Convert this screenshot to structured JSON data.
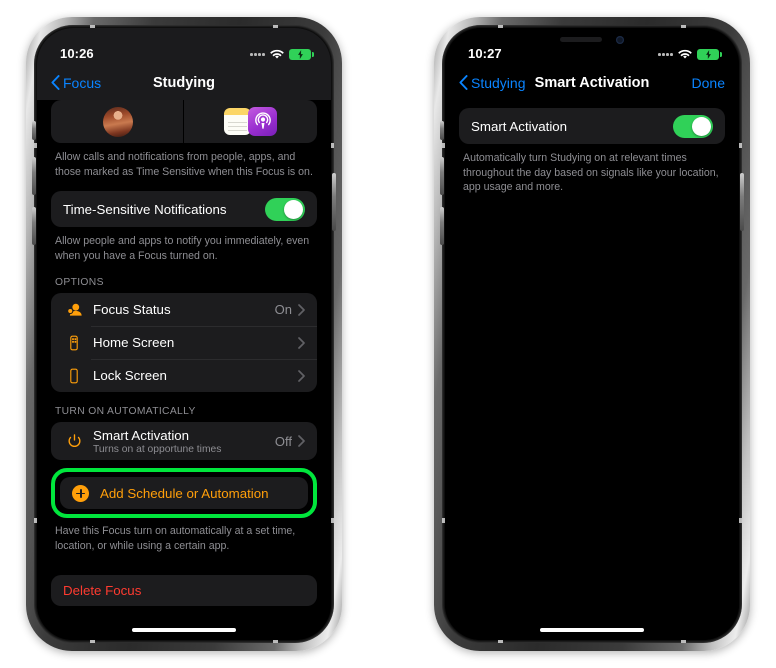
{
  "phones": [
    {
      "id": "focus-studying",
      "status_bar": {
        "time": "10:26",
        "signal": "signal-dots-icon",
        "wifi": "wifi-icon",
        "battery": "battery-charging-icon"
      },
      "nav": {
        "back_label": "Focus",
        "title": "Studying",
        "done_label": ""
      },
      "people_strip": {
        "avatar": "person-avatar",
        "app_icons": [
          "notes-app-icon",
          "podcasts-app-icon"
        ]
      },
      "footnote_1": "Allow calls and notifications from people, apps, and those marked as Time Sensitive when this Focus is on.",
      "time_sensitive": {
        "label": "Time-Sensitive Notifications",
        "toggle_state": "on"
      },
      "footnote_2": "Allow people and apps to notify you immediately, even when you have a Focus turned on.",
      "options_header": "OPTIONS",
      "options_rows": [
        {
          "label": "Focus Status",
          "value": "On",
          "icon": "focus-status-icon"
        },
        {
          "label": "Home Screen",
          "value": "",
          "icon": "home-screen-icon"
        },
        {
          "label": "Lock Screen",
          "value": "",
          "icon": "lock-screen-icon"
        }
      ],
      "turn_on_header": "TURN ON AUTOMATICALLY",
      "smart_activation_row": {
        "label": "Smart Activation",
        "sub": "Turns on at opportune times",
        "value": "Off",
        "icon": "power-icon"
      },
      "add_row": {
        "label": "Add Schedule or Automation",
        "icon": "plus-circle-icon"
      },
      "footnote_3": "Have this Focus turn on automatically at a set time, location, or while using a certain app.",
      "delete_label": "Delete Focus"
    },
    {
      "id": "smart-activation",
      "status_bar": {
        "time": "10:27",
        "signal": "signal-dots-icon",
        "wifi": "wifi-icon",
        "battery": "battery-charging-icon"
      },
      "nav": {
        "back_label": "Studying",
        "title": "Smart Activation",
        "done_label": "Done"
      },
      "smart_activation_toggle": {
        "label": "Smart Activation",
        "toggle_state": "on"
      },
      "footnote_1": "Automatically turn Studying on at relevant times throughout the day based on signals like your location, app usage and more."
    }
  ],
  "colors": {
    "highlight_green": "#00e63c",
    "toggle_green": "#30d158",
    "accent_orange": "#ff9f0a",
    "link_blue": "#0a84ff",
    "destructive_red": "#ff3b30",
    "card_bg": "#1c1c1e",
    "screen_bg": "#000000",
    "secondary_text": "#8e8e93"
  }
}
